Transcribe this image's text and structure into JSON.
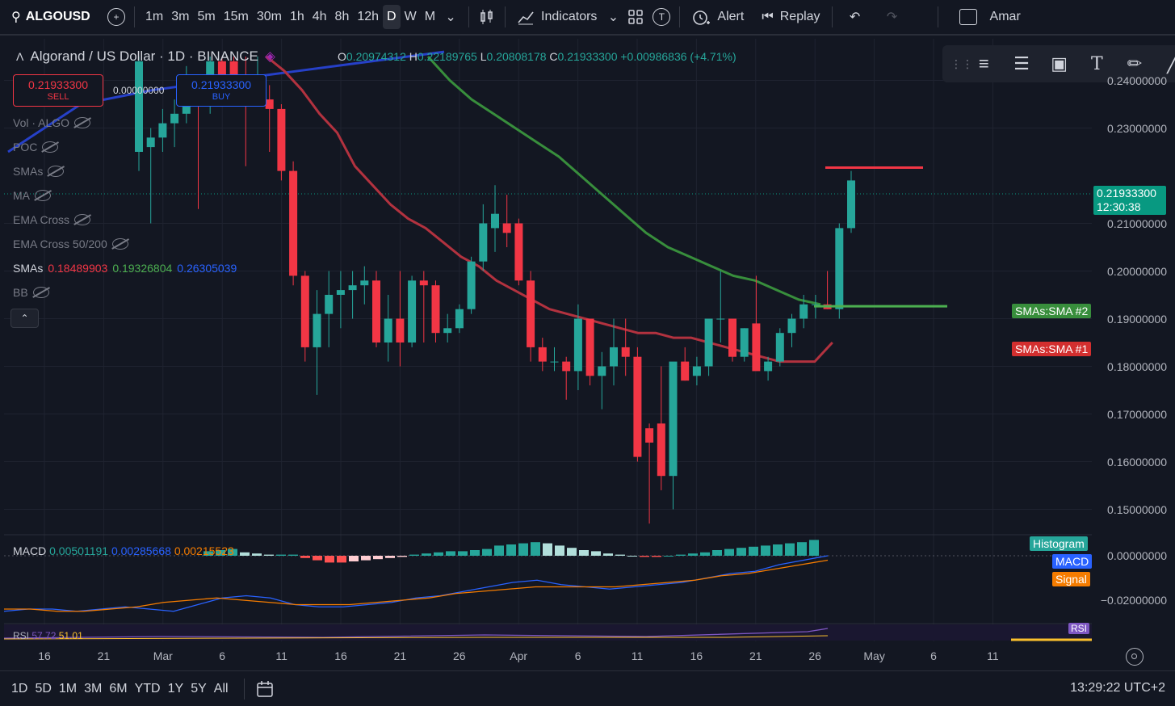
{
  "toolbar": {
    "symbol": "ALGOUSD",
    "intervals": [
      "1m",
      "3m",
      "5m",
      "15m",
      "30m",
      "1h",
      "4h",
      "8h",
      "12h",
      "D",
      "W",
      "M"
    ],
    "active_interval": "D",
    "indicators_label": "Indicators",
    "templates_badge": "T",
    "alert_label": "Alert",
    "replay_label": "Replay",
    "user_label": "Amar"
  },
  "legend": {
    "title": "Algorand / US Dollar · 1D · BINANCE",
    "open_label": "O",
    "open": "0.20974312",
    "high_label": "H",
    "high": "0.22189765",
    "low_label": "L",
    "low": "0.20808178",
    "close_label": "C",
    "close": "0.21933300",
    "change": "+0.00986836 (+4.71%)",
    "sell_price": "0.21933300",
    "sell_label": "SELL",
    "spread": "0.00000000",
    "buy_price": "0.21933300",
    "buy_label": "BUY",
    "indicators": [
      {
        "name": "Vol · ALGO"
      },
      {
        "name": "POC"
      },
      {
        "name": "SMAs"
      },
      {
        "name": "MA"
      },
      {
        "name": "EMA Cross"
      },
      {
        "name": "EMA Cross 50/200"
      }
    ],
    "smas_name": "SMAs",
    "smas_values": [
      "0.18489903",
      "0.19326804",
      "0.26305039"
    ],
    "bb_name": "BB"
  },
  "price_axis": {
    "labels": [
      "0.24000000",
      "0.23000000",
      "0.21000000",
      "0.20000000",
      "0.19000000",
      "0.18000000",
      "0.17000000",
      "0.16000000",
      "0.15000000"
    ],
    "current_price": "0.21933300",
    "countdown": "12:30:38",
    "sma2_tag": "SMAs:SMA #2",
    "sma1_tag": "SMAs:SMA #1"
  },
  "macd": {
    "name": "MACD",
    "values": [
      "0.00501191",
      "0.00285668",
      "0.00215523"
    ],
    "axis_labels": [
      "0.00000000",
      "−0.02000000"
    ],
    "tags": {
      "histogram": "Histogram",
      "macd": "MACD",
      "signal": "Signal"
    }
  },
  "rsi": {
    "tag": "RSI",
    "name": "RSI",
    "values": [
      "57.72",
      "51.01"
    ]
  },
  "time_axis": [
    "16",
    "21",
    "Mar",
    "6",
    "11",
    "16",
    "21",
    "26",
    "Apr",
    "6",
    "11",
    "16",
    "21",
    "26",
    "May",
    "6",
    "11"
  ],
  "bottom": {
    "ranges": [
      "1D",
      "5D",
      "1M",
      "3M",
      "6M",
      "YTD",
      "1Y",
      "5Y",
      "All"
    ],
    "clock": "13:29:22 UTC+2"
  },
  "colors": {
    "up": "#26a69a",
    "down": "#f23645",
    "sma1": "#b2323f",
    "sma2": "#388e3c",
    "sma3": "#2640c8",
    "macd": "#2962ff",
    "signal": "#f57c00",
    "rsi": "#7e57c2"
  },
  "chart_data": {
    "type": "candlestick",
    "ylim": [
      0.145,
      0.245
    ],
    "candles": [
      {
        "o": 0.225,
        "h": 0.245,
        "l": 0.221,
        "c": 0.244
      },
      {
        "o": 0.226,
        "h": 0.23,
        "l": 0.21,
        "c": 0.228
      },
      {
        "o": 0.228,
        "h": 0.234,
        "l": 0.225,
        "c": 0.231
      },
      {
        "o": 0.231,
        "h": 0.236,
        "l": 0.226,
        "c": 0.233
      },
      {
        "o": 0.233,
        "h": 0.243,
        "l": 0.231,
        "c": 0.239
      },
      {
        "o": 0.239,
        "h": 0.241,
        "l": 0.213,
        "c": 0.236
      },
      {
        "o": 0.236,
        "h": 0.245,
        "l": 0.233,
        "c": 0.244
      },
      {
        "o": 0.244,
        "h": 0.245,
        "l": 0.235,
        "c": 0.24
      },
      {
        "o": 0.244,
        "h": 0.245,
        "l": 0.236,
        "c": 0.24
      },
      {
        "o": 0.24,
        "h": 0.245,
        "l": 0.222,
        "c": 0.236
      },
      {
        "o": 0.236,
        "h": 0.245,
        "l": 0.235,
        "c": 0.238
      },
      {
        "o": 0.236,
        "h": 0.239,
        "l": 0.225,
        "c": 0.234
      },
      {
        "o": 0.234,
        "h": 0.235,
        "l": 0.219,
        "c": 0.221
      },
      {
        "o": 0.221,
        "h": 0.223,
        "l": 0.197,
        "c": 0.199
      },
      {
        "o": 0.199,
        "h": 0.2,
        "l": 0.181,
        "c": 0.184
      },
      {
        "o": 0.184,
        "h": 0.196,
        "l": 0.174,
        "c": 0.191
      },
      {
        "o": 0.191,
        "h": 0.2,
        "l": 0.184,
        "c": 0.195
      },
      {
        "o": 0.195,
        "h": 0.2,
        "l": 0.188,
        "c": 0.196
      },
      {
        "o": 0.196,
        "h": 0.2,
        "l": 0.19,
        "c": 0.197
      },
      {
        "o": 0.197,
        "h": 0.201,
        "l": 0.193,
        "c": 0.198
      },
      {
        "o": 0.198,
        "h": 0.2,
        "l": 0.184,
        "c": 0.185
      },
      {
        "o": 0.185,
        "h": 0.195,
        "l": 0.181,
        "c": 0.19
      },
      {
        "o": 0.19,
        "h": 0.2,
        "l": 0.18,
        "c": 0.185
      },
      {
        "o": 0.185,
        "h": 0.199,
        "l": 0.184,
        "c": 0.198
      },
      {
        "o": 0.198,
        "h": 0.2,
        "l": 0.185,
        "c": 0.197
      },
      {
        "o": 0.197,
        "h": 0.198,
        "l": 0.185,
        "c": 0.187
      },
      {
        "o": 0.187,
        "h": 0.191,
        "l": 0.185,
        "c": 0.188
      },
      {
        "o": 0.188,
        "h": 0.193,
        "l": 0.187,
        "c": 0.192
      },
      {
        "o": 0.192,
        "h": 0.203,
        "l": 0.191,
        "c": 0.202
      },
      {
        "o": 0.202,
        "h": 0.214,
        "l": 0.2,
        "c": 0.21
      },
      {
        "o": 0.209,
        "h": 0.218,
        "l": 0.204,
        "c": 0.212
      },
      {
        "o": 0.21,
        "h": 0.216,
        "l": 0.205,
        "c": 0.208
      },
      {
        "o": 0.21,
        "h": 0.211,
        "l": 0.197,
        "c": 0.198
      },
      {
        "o": 0.198,
        "h": 0.2,
        "l": 0.181,
        "c": 0.184
      },
      {
        "o": 0.184,
        "h": 0.186,
        "l": 0.179,
        "c": 0.181
      },
      {
        "o": 0.181,
        "h": 0.184,
        "l": 0.179,
        "c": 0.181
      },
      {
        "o": 0.181,
        "h": 0.182,
        "l": 0.173,
        "c": 0.179
      },
      {
        "o": 0.179,
        "h": 0.193,
        "l": 0.175,
        "c": 0.19
      },
      {
        "o": 0.19,
        "h": 0.19,
        "l": 0.176,
        "c": 0.178
      },
      {
        "o": 0.178,
        "h": 0.183,
        "l": 0.171,
        "c": 0.18
      },
      {
        "o": 0.18,
        "h": 0.19,
        "l": 0.176,
        "c": 0.184
      },
      {
        "o": 0.184,
        "h": 0.19,
        "l": 0.178,
        "c": 0.182
      },
      {
        "o": 0.182,
        "h": 0.184,
        "l": 0.16,
        "c": 0.161
      },
      {
        "o": 0.167,
        "h": 0.168,
        "l": 0.147,
        "c": 0.164
      },
      {
        "o": 0.168,
        "h": 0.18,
        "l": 0.154,
        "c": 0.157
      },
      {
        "o": 0.157,
        "h": 0.166,
        "l": 0.15,
        "c": 0.181
      },
      {
        "o": 0.181,
        "h": 0.184,
        "l": 0.177,
        "c": 0.177
      },
      {
        "o": 0.178,
        "h": 0.182,
        "l": 0.176,
        "c": 0.18
      },
      {
        "o": 0.18,
        "h": 0.19,
        "l": 0.178,
        "c": 0.19
      },
      {
        "o": 0.19,
        "h": 0.2,
        "l": 0.185,
        "c": 0.19
      },
      {
        "o": 0.19,
        "h": 0.19,
        "l": 0.181,
        "c": 0.182
      },
      {
        "o": 0.182,
        "h": 0.188,
        "l": 0.181,
        "c": 0.188
      },
      {
        "o": 0.189,
        "h": 0.199,
        "l": 0.182,
        "c": 0.179
      },
      {
        "o": 0.179,
        "h": 0.182,
        "l": 0.177,
        "c": 0.181
      },
      {
        "o": 0.181,
        "h": 0.188,
        "l": 0.18,
        "c": 0.187
      },
      {
        "o": 0.187,
        "h": 0.191,
        "l": 0.184,
        "c": 0.19
      },
      {
        "o": 0.19,
        "h": 0.195,
        "l": 0.188,
        "c": 0.193
      },
      {
        "o": 0.193,
        "h": 0.195,
        "l": 0.19,
        "c": 0.193
      },
      {
        "o": 0.193,
        "h": 0.2,
        "l": 0.192,
        "c": 0.192
      },
      {
        "o": 0.192,
        "h": 0.21,
        "l": 0.19,
        "c": 0.209
      },
      {
        "o": 0.209,
        "h": 0.221,
        "l": 0.208,
        "c": 0.219
      }
    ],
    "sma1": [
      0.245,
      0.242,
      0.238,
      0.233,
      0.229,
      0.222,
      0.218,
      0.214,
      0.211,
      0.209,
      0.206,
      0.203,
      0.201,
      0.198,
      0.196,
      0.194,
      0.192,
      0.191,
      0.19,
      0.189,
      0.188,
      0.187,
      0.187,
      0.186,
      0.186,
      0.185,
      0.184,
      0.183,
      0.182,
      0.181,
      0.181,
      0.181,
      0.185
    ],
    "sma2": [
      0.245,
      0.24,
      0.236,
      0.233,
      0.23,
      0.227,
      0.224,
      0.22,
      0.216,
      0.212,
      0.208,
      0.205,
      0.203,
      0.201,
      0.199,
      0.198,
      0.196,
      0.194,
      0.193
    ],
    "sma3": [
      0.225,
      0.235,
      0.238,
      0.24,
      0.242,
      0.244,
      0.246
    ],
    "sell_line": 0.2217,
    "sma2_level": 0.1926,
    "macd_hist": [
      0.0004,
      0.0005,
      0.0006,
      0.0003,
      0.0002,
      0.0001,
      0.0001,
      0.0001,
      -0.0002,
      -0.0004,
      -0.0006,
      -0.0006,
      -0.0005,
      -0.0004,
      -0.0003,
      -0.0002,
      -0.0001,
      0.0001,
      0.0002,
      0.0003,
      0.0004,
      0.0004,
      0.0005,
      0.0006,
      0.0009,
      0.001,
      0.0011,
      0.0012,
      0.0011,
      0.0009,
      0.0007,
      0.0005,
      0.0004,
      0.0002,
      0.0001,
      0.0,
      -0.0001,
      -0.0001,
      0.0,
      0.0001,
      0.0002,
      0.0003,
      0.0005,
      0.0006,
      0.0007,
      0.0008,
      0.0009,
      0.001,
      0.0011,
      0.0012,
      0.0014
    ],
    "macd_line": [
      -0.025,
      -0.024,
      -0.024,
      -0.025,
      -0.024,
      -0.023,
      -0.024,
      -0.025,
      -0.022,
      -0.019,
      -0.018,
      -0.019,
      -0.022,
      -0.023,
      -0.023,
      -0.022,
      -0.021,
      -0.019,
      -0.018,
      -0.016,
      -0.014,
      -0.012,
      -0.011,
      -0.013,
      -0.014,
      -0.015,
      -0.014,
      -0.013,
      -0.012,
      -0.01,
      -0.008,
      -0.007,
      -0.004,
      -0.002,
      0.0
    ],
    "signal_line": [
      -0.024,
      -0.024,
      -0.025,
      -0.025,
      -0.024,
      -0.023,
      -0.021,
      -0.02,
      -0.019,
      -0.02,
      -0.021,
      -0.022,
      -0.022,
      -0.022,
      -0.021,
      -0.02,
      -0.019,
      -0.017,
      -0.016,
      -0.015,
      -0.014,
      -0.014,
      -0.014,
      -0.014,
      -0.013,
      -0.012,
      -0.011,
      -0.009,
      -0.008,
      -0.006,
      -0.004,
      -0.002
    ]
  }
}
